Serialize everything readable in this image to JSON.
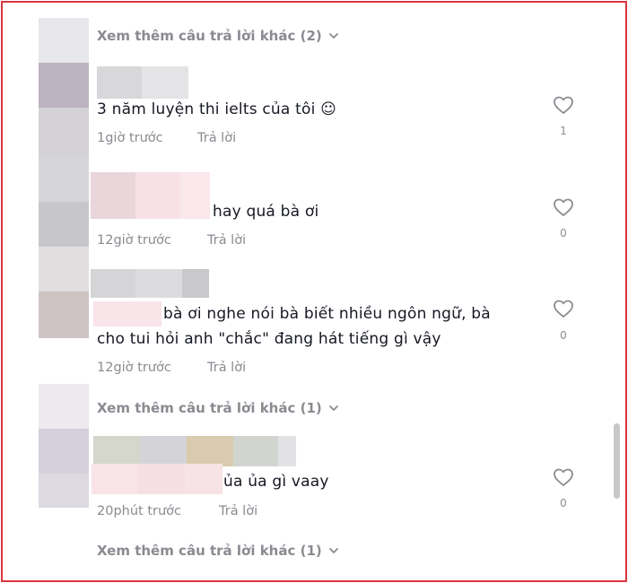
{
  "more_replies": [
    {
      "label": "Xem thêm câu trả lời khác (2)"
    },
    {
      "label": "Xem thêm câu trả lời khác (1)"
    },
    {
      "label": "Xem thêm câu trả lời khác (1)"
    }
  ],
  "comments": [
    {
      "text": "3 năm luyện thi ielts của tôi ☺",
      "time": "1giờ trước",
      "reply_label": "Trả lời",
      "likes": "1"
    },
    {
      "text": "hay quá bà ơi",
      "time": "12giờ trước",
      "reply_label": "Trả lời",
      "likes": "0"
    },
    {
      "text_line1": "bà ơi nghe nói bà biết nhiều ngôn ngữ, bà",
      "text_line2": "cho tui hỏi anh \"chắc\" đang hát tiếng gì vậy",
      "time": "12giờ trước",
      "reply_label": "Trả lời",
      "likes": "0"
    },
    {
      "text": "ủa ủa gì vaay",
      "time": "20phút trước",
      "reply_label": "Trả lời",
      "likes": "0"
    }
  ],
  "colors": {
    "frame_border": "#d9363e",
    "muted_text": "#8a8b91",
    "main_text": "#161823"
  },
  "icons": {
    "like": "heart-outline-icon",
    "expand": "chevron-down-icon"
  }
}
